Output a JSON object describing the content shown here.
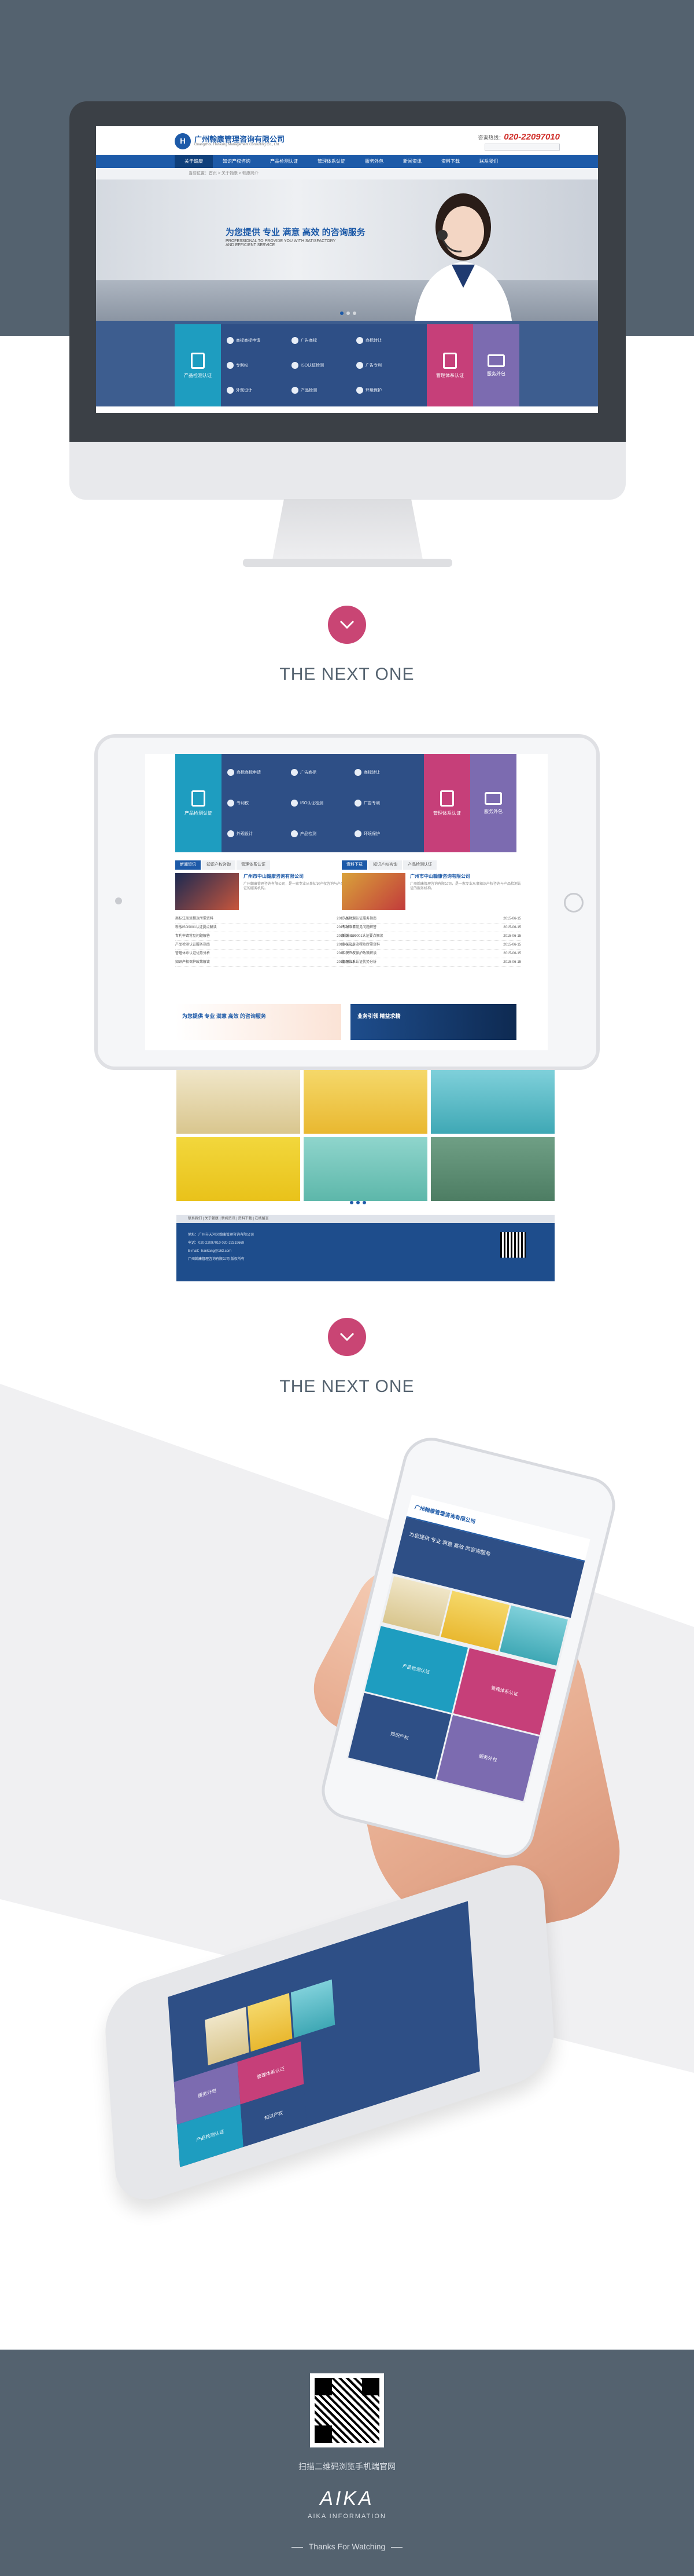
{
  "site": {
    "company_name": "广州翰康管理咨询有限公司",
    "company_sub": "Guangzhou Hankang Management Consulting Co., Ltd.",
    "hotline_label": "咨询热线：",
    "hotline_number": "020-22097010",
    "nav": [
      "关于翰康",
      "知识产权咨询",
      "产品检测认证",
      "管理体系认证",
      "服务外包",
      "新闻资讯",
      "资料下载",
      "联系我们"
    ],
    "breadcrumb": "当前位置：首页 > 关于翰康 > 翰康简介",
    "hero_title": "为您提供 专业 满意 高效 的咨询服务",
    "hero_sub": "PROFESSIONAL TO PROVIDE YOU WITH SATISFACTORY AND EFFICIENT SERVICE",
    "tile_main": "产品检测认证",
    "tiles": [
      "商标商标申请",
      "广告商标",
      "商标转让",
      "专利权",
      "ISO认证检测",
      "广告专利",
      "外观设计",
      "产品检测",
      "环境保护"
    ],
    "tile_pink": "管理体系认证",
    "tile_violet": "服务外包",
    "tabs_left": [
      "新闻资讯",
      "知识产权咨询",
      "管理体系认证"
    ],
    "tabs_right": [
      "资料下载",
      "知识产权咨询",
      "产品检测认证"
    ],
    "news_left_title": "广州市中山翰康咨询有限公司",
    "news_right_title": "广州市中山翰康咨询有限公司",
    "news_desc": "广州翰康管理咨询有限公司，是一家专业从事知识产权咨询与产品检测认证的服务机构。",
    "news_items": [
      "商标注册流程及所需资料",
      "新版ISO9001认证要点解读",
      "专利申请常见问题解答",
      "产品检测认证服务指南",
      "管理体系认证优势分析",
      "知识产权保护政策解读"
    ],
    "news_date": "2015-06-15",
    "banner_a": "为您提供 专业 满意 高效 的咨询服务",
    "banner_b": "业务引领 精益求精",
    "footnav": "联系我们 | 关于翰康 | 新闻资讯 | 资料下载 | 在线留言",
    "footer_lines": [
      "地址：广州市天河区翰康管理咨询有限公司",
      "电话：020-22097010   020-22319669",
      "E-mail：hankang@163.com",
      "广州翰康管理咨询有限公司 版权所有"
    ]
  },
  "mobile": {
    "header": "广州翰康管理咨询有限公司",
    "hero": "为您提供 专业 满意 高效 的咨询服务",
    "tiles": [
      {
        "label": "产品检测认证",
        "color": "#1e9dc0"
      },
      {
        "label": "管理体系认证",
        "color": "#c63f79"
      },
      {
        "label": "知识产权",
        "color": "#2e4f86"
      },
      {
        "label": "服务外包",
        "color": "#7c6bb0"
      }
    ]
  },
  "captions": {
    "next1": "THE NEXT ONE",
    "next2": "THE NEXT ONE"
  },
  "footer": {
    "scan_text": "扫描二维码浏览手机端官网",
    "brand": "AIKA",
    "brand_sub": "AIKA INFORMATION",
    "thanks": "Thanks For Watching"
  },
  "colors": {
    "slate": "#54626f",
    "accent_pink": "#c94574",
    "site_blue": "#1d5aa8"
  }
}
